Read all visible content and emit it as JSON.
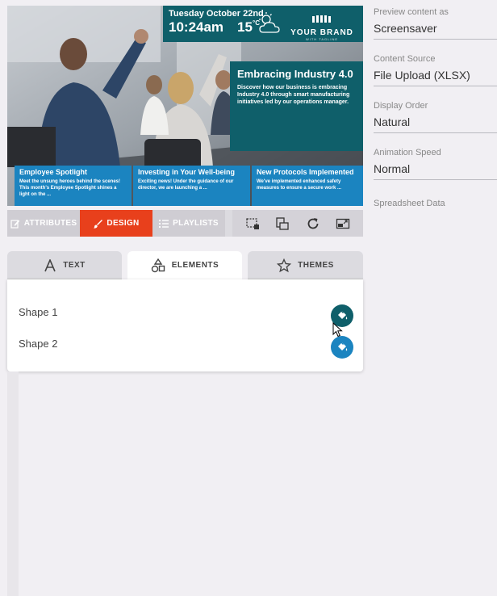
{
  "preview": {
    "header": {
      "date": "Tuesday October 22nd",
      "time": "10:24am",
      "temperature": "15",
      "temp_unit": "°C",
      "weather_icon": "partly-cloudy-icon",
      "brand_name": "YOUR BRAND",
      "brand_tagline": "WITH TAGLINE"
    },
    "feature": {
      "title": "Embracing Industry 4.0",
      "body": "Discover how our business is embracing Industry 4.0 through smart manufacturing initiatives led by our operations manager."
    },
    "news": [
      {
        "title": "Employee Spotlight",
        "body": "Meet the unsung heroes behind the scenes! This month's Employee Spotlight shines a light on the ..."
      },
      {
        "title": "Investing in Your Well-being",
        "body": "Exciting news! Under the guidance of our director, we are launching a ..."
      },
      {
        "title": "New Protocols Implemented",
        "body": "We've implemented enhanced safety measures to ensure a secure work ..."
      }
    ]
  },
  "settings": [
    {
      "label": "Preview content as",
      "value": "Screensaver"
    },
    {
      "label": "Content Source",
      "value": "File Upload (XLSX)"
    },
    {
      "label": "Display Order",
      "value": "Natural"
    },
    {
      "label": "Animation Speed",
      "value": "Normal"
    },
    {
      "label": "Spreadsheet Data",
      "value": ""
    }
  ],
  "toolbar": {
    "attributes_label": "ATTRIBUTES",
    "design_label": "DESIGN",
    "playlists_label": "PLAYLISTS",
    "icons": [
      "crop-icon",
      "resize-icon",
      "refresh-icon",
      "fullscreen-icon"
    ]
  },
  "tabs": {
    "text_label": "TEXT",
    "elements_label": "ELEMENTS",
    "themes_label": "THEMES"
  },
  "elements": [
    {
      "label": "Shape 1",
      "color": "#0f5f6a"
    },
    {
      "label": "Shape 2",
      "color": "#1b84c0"
    }
  ],
  "colors": {
    "accent": "#e8401c",
    "teal": "#0f5f6a",
    "blue": "#1b84c0"
  }
}
